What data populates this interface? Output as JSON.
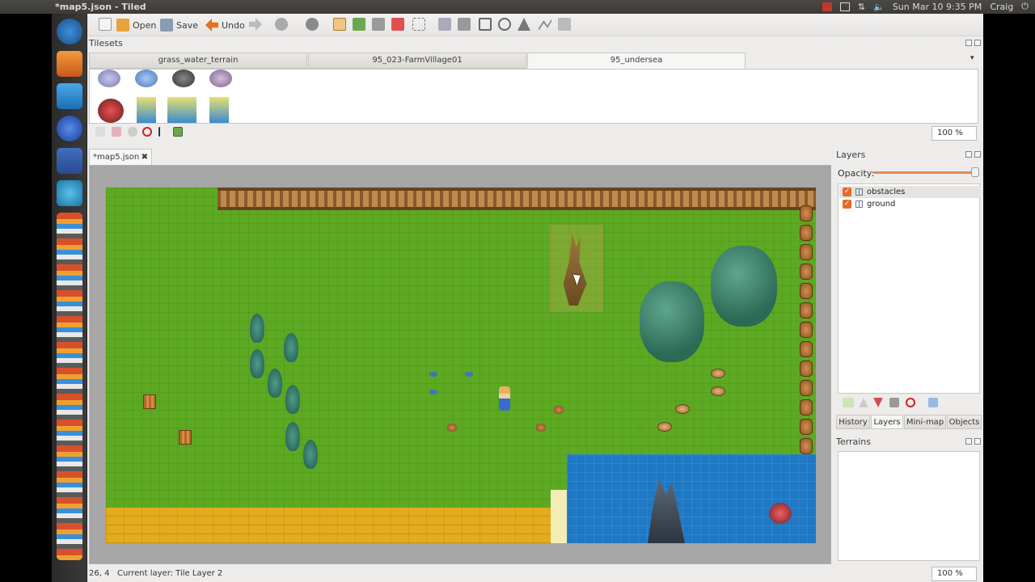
{
  "window": {
    "title": "*map5.json - Tiled"
  },
  "system_tray": {
    "datetime": "Sun Mar 10  9:35 PM",
    "user": "Craig"
  },
  "toolbar": {
    "open_label": "Open",
    "save_label": "Save",
    "undo_label": "Undo"
  },
  "tilesets": {
    "title": "Tilesets",
    "tabs": [
      "grass_water_terrain",
      "95_023-FarmVillage01",
      "95_undersea"
    ],
    "active_tab": "95_undersea",
    "zoom": "100 %"
  },
  "document": {
    "tab_label": "*map5.json"
  },
  "layers": {
    "title": "Layers",
    "opacity_label": "Opacity:",
    "opacity_value": 1.0,
    "items": [
      {
        "name": "obstacles",
        "visible": true,
        "selected": true
      },
      {
        "name": "ground",
        "visible": true,
        "selected": false
      }
    ]
  },
  "dock_tabs": [
    "History",
    "Layers",
    "Mini-map",
    "Objects"
  ],
  "dock_active_tab": "Layers",
  "terrains": {
    "title": "Terrains"
  },
  "status": {
    "text": "26, 4   Current layer: Tile Layer 2",
    "zoom": "100 %"
  },
  "colors": {
    "accent": "#e66a28",
    "grass": "#5daa22",
    "water": "#1f78c4",
    "field": "#e0a617"
  }
}
